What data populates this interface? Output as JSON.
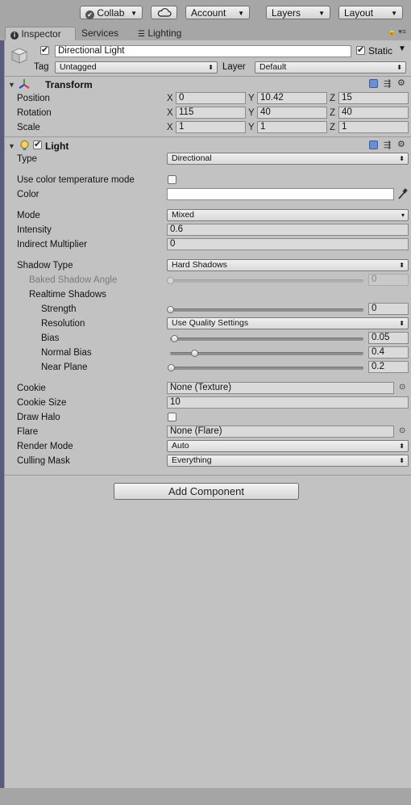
{
  "toolbar": {
    "collab_label": "Collab",
    "account_label": "Account",
    "layers_label": "Layers",
    "layout_label": "Layout"
  },
  "tabs": [
    {
      "label": "Inspector",
      "icon": "info-icon"
    },
    {
      "label": "Services"
    },
    {
      "label": "Lighting",
      "icon": "sliders-icon"
    }
  ],
  "object": {
    "enabled": true,
    "name": "Directional Light",
    "static_label": "Static",
    "static": true,
    "tag_label": "Tag",
    "tag": "Untagged",
    "layer_label": "Layer",
    "layer": "Default"
  },
  "transform": {
    "title": "Transform",
    "rows": [
      {
        "label": "Position",
        "x": "0",
        "y": "10.42",
        "z": "15"
      },
      {
        "label": "Rotation",
        "x": "115",
        "y": "40",
        "z": "40"
      },
      {
        "label": "Scale",
        "x": "1",
        "y": "1",
        "z": "1"
      }
    ],
    "axis": {
      "x": "X",
      "y": "Y",
      "z": "Z"
    }
  },
  "light": {
    "title": "Light",
    "enabled": true,
    "type_label": "Type",
    "type": "Directional",
    "color_temp_label": "Use color temperature mode",
    "color_label": "Color",
    "color": "#ffffff",
    "mode_label": "Mode",
    "mode": "Mixed",
    "intensity_label": "Intensity",
    "intensity": "0.6",
    "indirect_label": "Indirect Multiplier",
    "indirect": "0",
    "shadow_type_label": "Shadow Type",
    "shadow_type": "Hard Shadows",
    "baked_angle_label": "Baked Shadow Angle",
    "baked_angle": "0",
    "realtime_label": "Realtime Shadows",
    "strength_label": "Strength",
    "strength": "0",
    "resolution_label": "Resolution",
    "resolution": "Use Quality Settings",
    "bias_label": "Bias",
    "bias": "0.05",
    "normal_bias_label": "Normal Bias",
    "normal_bias": "0.4",
    "near_plane_label": "Near Plane",
    "near_plane": "0.2",
    "cookie_label": "Cookie",
    "cookie": "None (Texture)",
    "cookie_size_label": "Cookie Size",
    "cookie_size": "10",
    "draw_halo_label": "Draw Halo",
    "flare_label": "Flare",
    "flare": "None (Flare)",
    "render_mode_label": "Render Mode",
    "render_mode": "Auto",
    "culling_label": "Culling Mask",
    "culling": "Everything"
  },
  "add_component_label": "Add Component"
}
